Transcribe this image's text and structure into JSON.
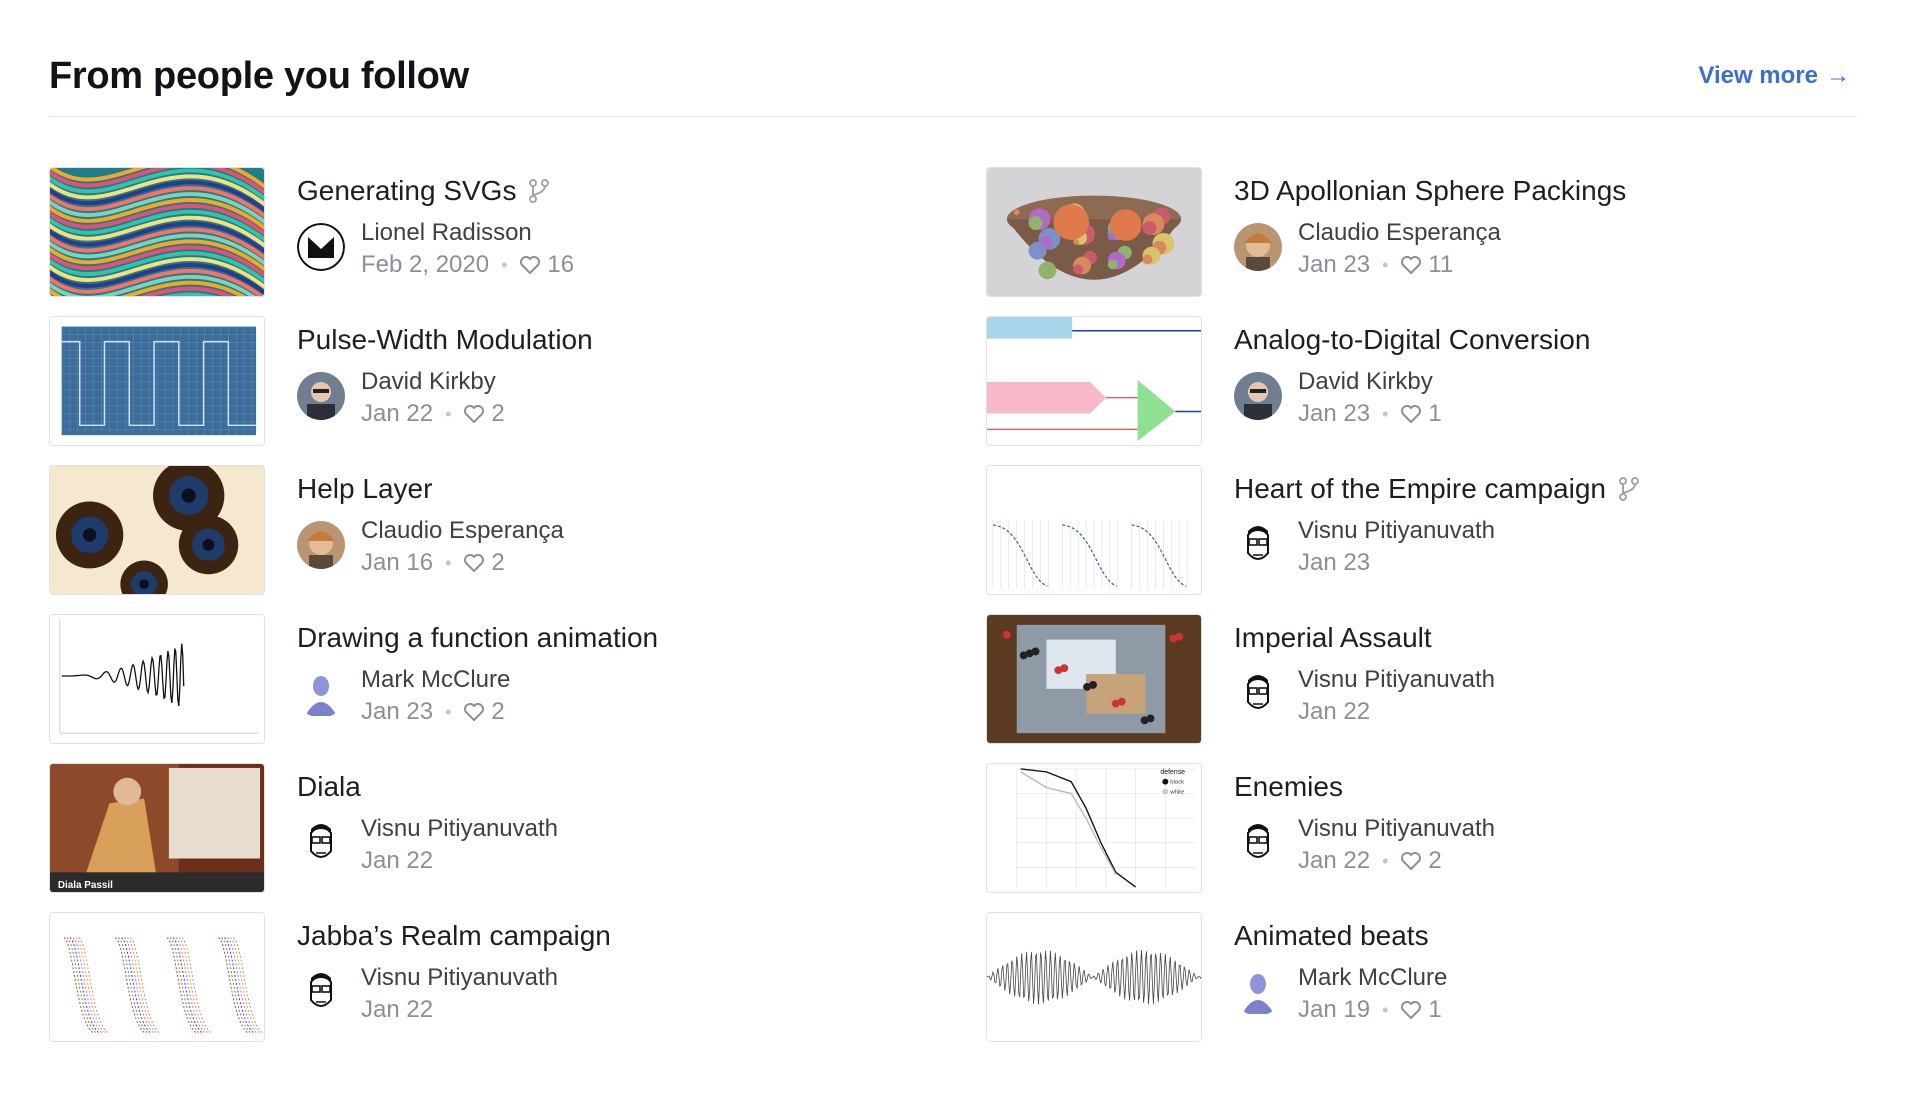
{
  "header": {
    "title": "From people you follow",
    "view_more": "View more",
    "view_more_arrow": "→"
  },
  "colors": {
    "accent": "#3b6fd2",
    "muted": "#8a8f98",
    "text": "#1b1e23"
  },
  "left": [
    {
      "title": "Generating SVGs",
      "forked": true,
      "author": "Lionel Radisson",
      "date": "Feb 2, 2020",
      "likes": "16",
      "thumb": "swirl",
      "avatar": "m-logo"
    },
    {
      "title": "Pulse-Width Modulation",
      "author": "David Kirkby",
      "date": "Jan 22",
      "likes": "2",
      "thumb": "pwm",
      "avatar": "photo-grey"
    },
    {
      "title": "Help Layer",
      "author": "Claudio Esperança",
      "date": "Jan 16",
      "likes": "2",
      "thumb": "fractal",
      "avatar": "photo-tan"
    },
    {
      "title": "Drawing a function animation",
      "author": "Mark McClure",
      "date": "Jan 23",
      "likes": "2",
      "thumb": "wave",
      "avatar": "bust"
    },
    {
      "title": "Diala",
      "author": "Visnu Pitiyanuvath",
      "date": "Jan 22",
      "likes": "",
      "thumb": "card-art",
      "thumb_label": "Diala Passil",
      "avatar": "sketch-face"
    },
    {
      "title": "Jabba’s Realm campaign",
      "author": "Visnu Pitiyanuvath",
      "date": "Jan 22",
      "likes": "",
      "thumb": "multi-plot",
      "avatar": "sketch-face"
    }
  ],
  "right": [
    {
      "title": "3D Apollonian Sphere Packings",
      "author": "Claudio Esperança",
      "date": "Jan 23",
      "likes": "11",
      "thumb": "spheres",
      "avatar": "photo-tan"
    },
    {
      "title": "Analog-to-Digital Conversion",
      "author": "David Kirkby",
      "date": "Jan 23",
      "likes": "1",
      "thumb": "adc",
      "avatar": "photo-grey"
    },
    {
      "title": "Heart of the Empire campaign",
      "forked": true,
      "author": "Visnu Pitiyanuvath",
      "date": "Jan 23",
      "likes": "",
      "thumb": "curves",
      "avatar": "sketch-face"
    },
    {
      "title": "Imperial Assault",
      "author": "Visnu Pitiyanuvath",
      "date": "Jan 22",
      "likes": "",
      "thumb": "board",
      "avatar": "sketch-face"
    },
    {
      "title": "Enemies",
      "author": "Visnu Pitiyanuvath",
      "date": "Jan 22",
      "likes": "2",
      "thumb": "defense",
      "thumb_legend": [
        "defense",
        "black",
        "white"
      ],
      "avatar": "sketch-face"
    },
    {
      "title": "Animated beats",
      "author": "Mark McClure",
      "date": "Jan 19",
      "likes": "1",
      "thumb": "beats",
      "avatar": "bust"
    }
  ]
}
